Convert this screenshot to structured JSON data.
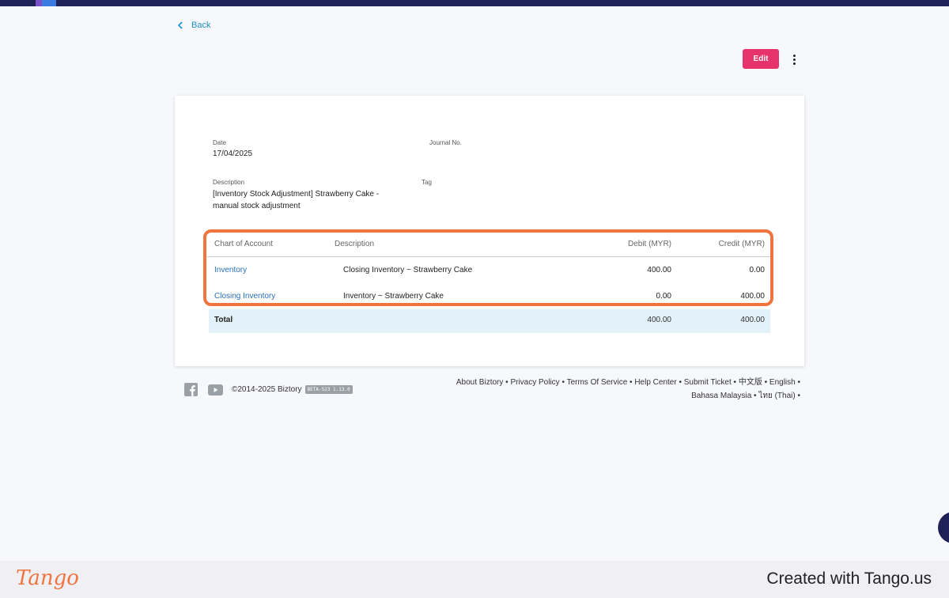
{
  "nav": {
    "back_label": "Back"
  },
  "toolbar": {
    "edit_label": "Edit"
  },
  "journal": {
    "date_label": "Date",
    "date_value": "17/04/2025",
    "journal_no_label": "Journal No.",
    "description_label": "Description",
    "description_line1": "[Inventory Stock Adjustment] Strawberry Cake -",
    "description_line2": "manual stock adjustment",
    "tag_label": "Tag"
  },
  "table": {
    "headers": [
      "Chart of Account",
      "Description",
      "Debit (MYR)",
      "Credit (MYR)"
    ],
    "rows": [
      {
        "account": "Inventory",
        "description": "Closing Inventory ~ Strawberry Cake",
        "debit": "400.00",
        "credit": "0.00"
      },
      {
        "account": "Closing Inventory",
        "description": "Inventory ~ Strawberry Cake",
        "debit": "0.00",
        "credit": "400.00"
      }
    ],
    "total_label": "Total",
    "total_debit": "400.00",
    "total_credit": "400.00"
  },
  "footer": {
    "copyright": "©2014-2025 Biztory",
    "beta": "BETA-523 1.13.0",
    "links": [
      "About Biztory",
      "Privacy Policy",
      "Terms Of Service",
      "Help Center",
      "Submit Ticket",
      "中文版",
      "English",
      "Bahasa Malaysia",
      "ไทย (Thai)"
    ],
    "separator": " • "
  },
  "tango": {
    "logo": "Tango",
    "credit": "Created with Tango.us"
  },
  "colors": {
    "accent": "#e6336b",
    "link": "#2a6fb5",
    "highlight": "#f0743e",
    "nav": "#1f2257"
  },
  "icons": [
    "chevron-left-icon",
    "kebab-menu-icon",
    "facebook-icon",
    "youtube-icon"
  ]
}
